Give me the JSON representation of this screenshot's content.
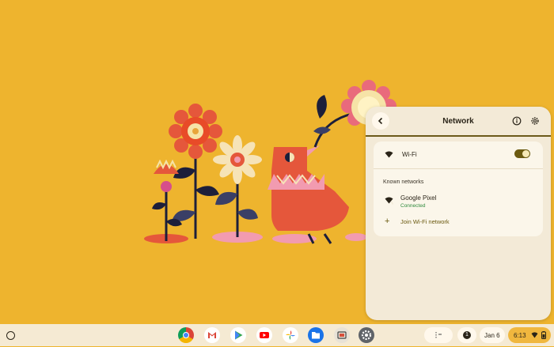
{
  "network_panel": {
    "title": "Network",
    "back_icon": "chevron-left-icon",
    "info_icon": "info-icon",
    "settings_icon": "gear-icon",
    "wifi_label": "Wi-Fi",
    "wifi_enabled": true,
    "known_networks_label": "Known networks",
    "networks": [
      {
        "name": "Google Pixel",
        "status": "Connected",
        "icon": "wifi-signal-icon"
      }
    ],
    "join_label": "Join Wi-Fi network",
    "join_icon": "plus-icon"
  },
  "shelf": {
    "apps": [
      "chrome",
      "gmail",
      "play-store",
      "youtube",
      "photos",
      "files",
      "screen-capture",
      "settings"
    ],
    "notification_count": "1",
    "date": "Jan 6",
    "time": "6:13"
  },
  "colors": {
    "wallpaper": "#eeb42e",
    "panel": "#f3ead7",
    "accent": "#6b5a10",
    "connected": "#2e8a3c"
  }
}
